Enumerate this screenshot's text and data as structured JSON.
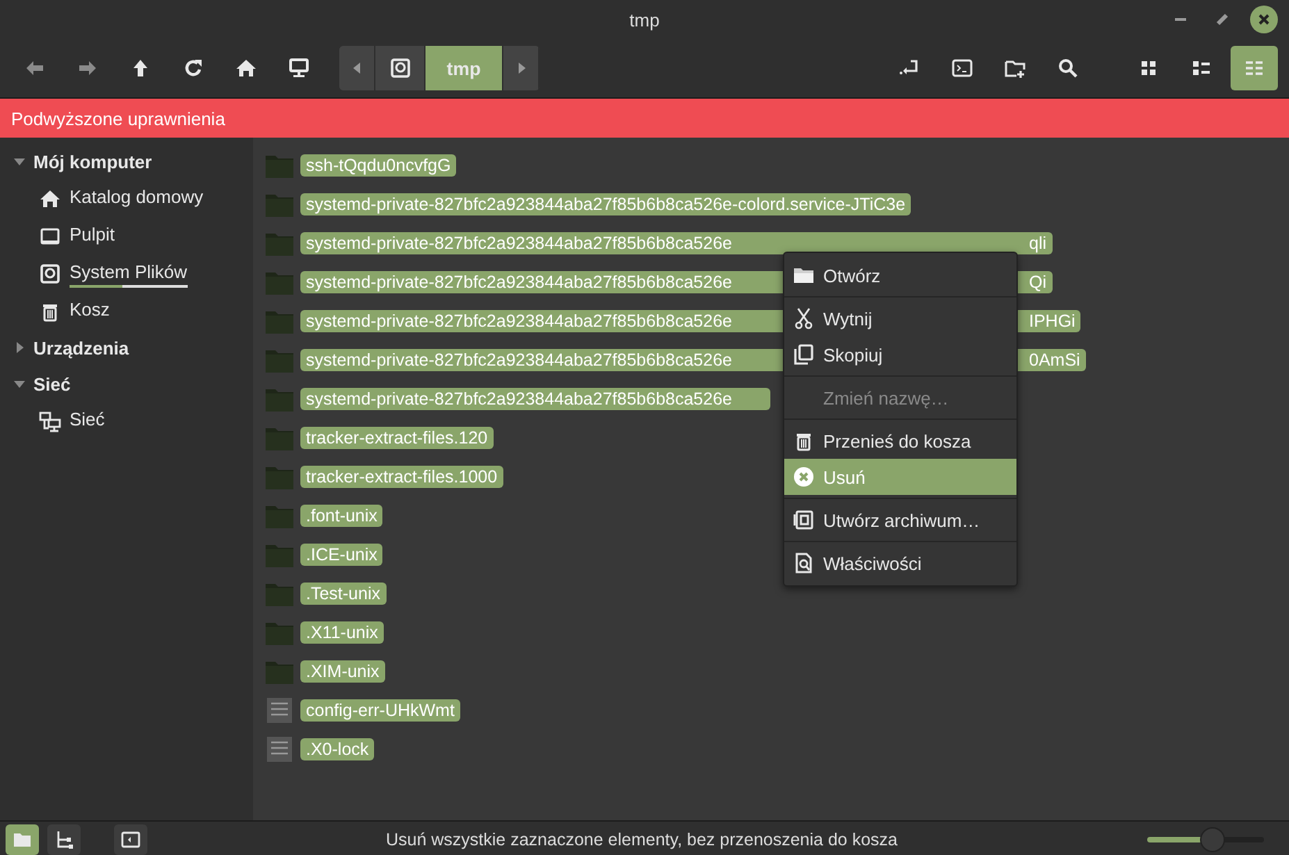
{
  "window": {
    "title": "tmp"
  },
  "toolbar": {
    "nav": [
      {
        "kind": "back",
        "disabled": true
      },
      {
        "kind": "forward",
        "disabled": true
      },
      {
        "kind": "up",
        "disabled": false
      },
      {
        "kind": "reload",
        "disabled": false
      },
      {
        "kind": "home",
        "disabled": false
      },
      {
        "kind": "computer",
        "disabled": false
      }
    ],
    "path": [
      {
        "kind": "drive",
        "selected": false
      },
      {
        "kind": "text",
        "label": "tmp",
        "selected": true
      }
    ],
    "views": [
      {
        "kind": "icons",
        "selected": false
      },
      {
        "kind": "compact",
        "selected": false
      },
      {
        "kind": "list",
        "selected": true
      }
    ]
  },
  "banner": "Podwyższone uprawnienia",
  "sidebar": [
    {
      "label": "Mój komputer",
      "expanded": true,
      "items": [
        {
          "label": "Katalog domowy",
          "kind": "home"
        },
        {
          "label": "Pulpit",
          "kind": "desktop"
        },
        {
          "label": "System Plików",
          "kind": "drive",
          "level": 0.45
        },
        {
          "label": "Kosz",
          "kind": "trash"
        }
      ]
    },
    {
      "label": "Urządzenia",
      "expanded": false
    },
    {
      "label": "Sieć",
      "expanded": true,
      "items": [
        {
          "label": "Sieć",
          "kind": "network"
        }
      ]
    }
  ],
  "files": [
    {
      "name": "ssh-tQqdu0ncvfgG",
      "kind": "folder"
    },
    {
      "name": "systemd-private-827bfc2a923844aba27f85b6b8ca526e-colord.service-JTiC3e",
      "kind": "folder"
    },
    {
      "name": "systemd-private-827bfc2a923844aba27f85b6b8ca526e",
      "tail": "qli",
      "kind": "folder"
    },
    {
      "name": "systemd-private-827bfc2a923844aba27f85b6b8ca526e",
      "tail": "Qi",
      "kind": "folder"
    },
    {
      "name": "systemd-private-827bfc2a923844aba27f85b6b8ca526e",
      "tail": "IPHGi",
      "kind": "folder"
    },
    {
      "name": "systemd-private-827bfc2a923844aba27f85b6b8ca526e",
      "tail": "0AmSi",
      "kind": "folder"
    },
    {
      "name": "systemd-private-827bfc2a923844aba27f85b6b8ca526e",
      "kind": "folder"
    },
    {
      "name": "tracker-extract-files.120",
      "kind": "folder"
    },
    {
      "name": "tracker-extract-files.1000",
      "kind": "folder"
    },
    {
      "name": ".font-unix",
      "kind": "folder"
    },
    {
      "name": ".ICE-unix",
      "kind": "folder"
    },
    {
      "name": ".Test-unix",
      "kind": "folder"
    },
    {
      "name": ".X11-unix",
      "kind": "folder"
    },
    {
      "name": ".XIM-unix",
      "kind": "folder"
    },
    {
      "name": "config-err-UHkWmt",
      "kind": "text"
    },
    {
      "name": ".X0-lock",
      "kind": "text"
    }
  ],
  "context_menu": [
    {
      "kind": "open",
      "label": "Otwórz",
      "disabled": false,
      "selected": false
    },
    {
      "kind": "separator"
    },
    {
      "kind": "cut",
      "label": "Wytnij",
      "disabled": false,
      "selected": false
    },
    {
      "kind": "copy",
      "label": "Skopiuj",
      "disabled": false,
      "selected": false
    },
    {
      "kind": "separator"
    },
    {
      "kind": "rename",
      "label": "Zmień nazwę…",
      "disabled": true,
      "selected": false
    },
    {
      "kind": "separator"
    },
    {
      "kind": "trash",
      "label": "Przenieś do kosza",
      "disabled": false,
      "selected": false
    },
    {
      "kind": "delete",
      "label": "Usuń",
      "disabled": false,
      "selected": true
    },
    {
      "kind": "separator"
    },
    {
      "kind": "archive",
      "label": "Utwórz archiwum…",
      "disabled": false,
      "selected": false
    },
    {
      "kind": "separator"
    },
    {
      "kind": "properties",
      "label": "Właściwości",
      "disabled": false,
      "selected": false
    }
  ],
  "status_bar": {
    "panes": [
      {
        "kind": "places",
        "selected": true
      },
      {
        "kind": "tree",
        "selected": false
      }
    ],
    "text": "Usuń wszystkie zaznaczone elementy, bez przenoszenia do kosza",
    "zoom": {
      "level": 0.55
    }
  }
}
